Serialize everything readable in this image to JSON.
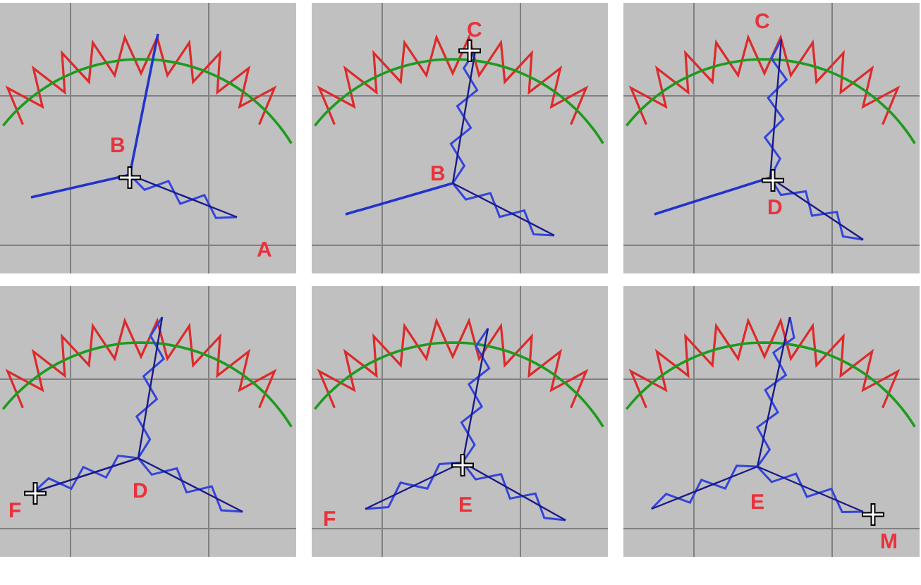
{
  "panels": [
    {
      "labels": [
        "B",
        "A"
      ]
    },
    {
      "labels": [
        "C",
        "B"
      ]
    },
    {
      "labels": [
        "C",
        "D"
      ]
    },
    {
      "labels": [
        "F",
        "D"
      ]
    },
    {
      "labels": [
        "F",
        "E"
      ]
    },
    {
      "labels": [
        "E",
        "M"
      ]
    }
  ]
}
